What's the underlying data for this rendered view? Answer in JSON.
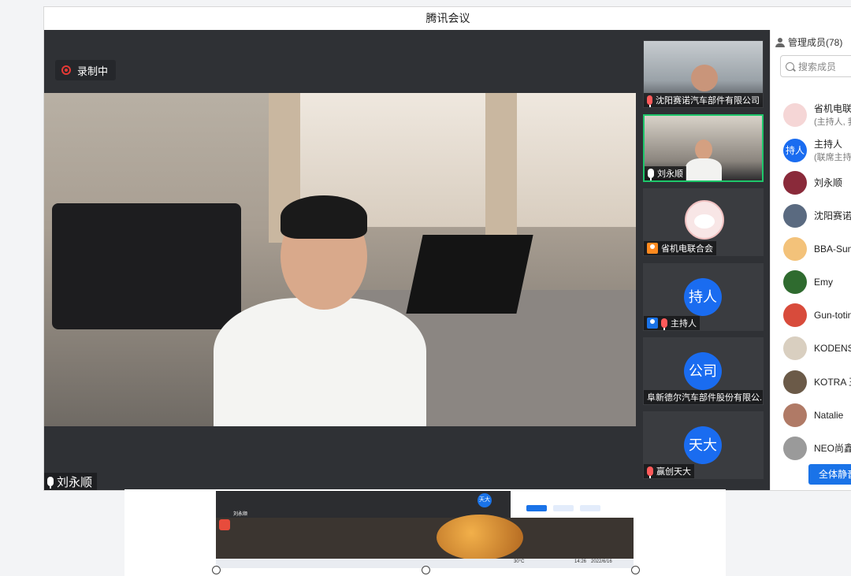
{
  "window": {
    "title": "腾讯会议"
  },
  "recording": {
    "label": "录制中"
  },
  "main_video": {
    "speaker": "刘永顺"
  },
  "thumbnails": [
    {
      "label": "沈阳赛诺汽车部件有限公司",
      "type": "camera",
      "mic": "muted"
    },
    {
      "label": "刘永顺",
      "type": "camera",
      "mic": "on",
      "active": true
    },
    {
      "label": "省机电联合会",
      "type": "cat-avatar",
      "mic": "none"
    },
    {
      "label": "主持人",
      "type": "avatar",
      "avatar_text": "持人",
      "mic": "muted"
    },
    {
      "label": "阜新德尔汽车部件股份有限公...",
      "type": "avatar",
      "avatar_text": "公司",
      "mic": "none"
    },
    {
      "label": "赢创天大",
      "type": "avatar",
      "avatar_text": "天大",
      "mic": "muted"
    }
  ],
  "members_panel": {
    "title": "管理成员(78)",
    "search_placeholder": "搜索成员",
    "members": [
      {
        "name": "省机电联合会",
        "sub": "(主持人, 我)",
        "avatar_color": "#f5d6d6"
      },
      {
        "name": "主持人",
        "sub": "(联席主持人)",
        "avatar_text": "持人",
        "avatar_color": "#1a6cf0"
      },
      {
        "name": "刘永顺",
        "sub": "",
        "avatar_color": "#8a2a3a"
      },
      {
        "name": "沈阳赛诺汽车",
        "sub": "",
        "avatar_color": "#5a6a80"
      },
      {
        "name": "BBA-Sumi",
        "sub": "",
        "avatar_color": "#f3c27a"
      },
      {
        "name": "Emy",
        "sub": "",
        "avatar_color": "#2f6b2f"
      },
      {
        "name": "Gun-toting",
        "sub": "",
        "avatar_color": "#d84b3b"
      },
      {
        "name": "KODENSHI",
        "sub": "",
        "avatar_color": "#d9cfc0"
      },
      {
        "name": "KOTRA 王",
        "sub": "",
        "avatar_color": "#6b5a48"
      },
      {
        "name": "Natalie",
        "sub": "",
        "avatar_color": "#b07a66"
      },
      {
        "name": "NEO尚鑫",
        "sub": "",
        "avatar_color": "#9a9a9a"
      }
    ],
    "mute_all_label": "全体静音"
  },
  "desktop_preview": {
    "speaker": "刘永顺",
    "tile": "天大",
    "taskbar_time": "14:26",
    "taskbar_date": "2022/6/16",
    "weather": "30°C"
  },
  "colors": {
    "accent": "#1a73e8",
    "record": "#e53935",
    "active_border": "#1ec76b"
  }
}
